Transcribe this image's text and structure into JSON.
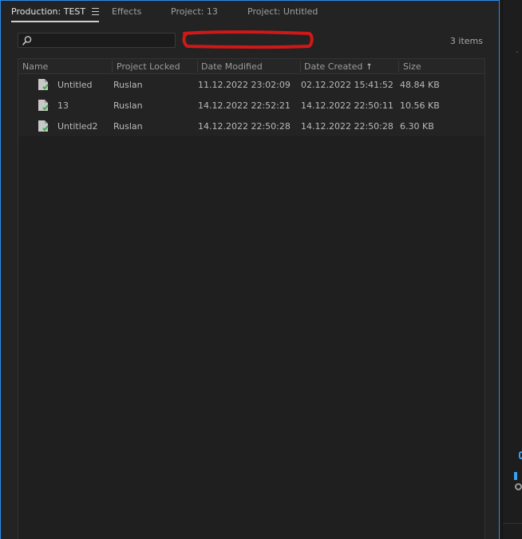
{
  "tabs": [
    {
      "label": "Production: TEST",
      "active": true
    },
    {
      "label": "Effects",
      "active": false
    },
    {
      "label": "Project: 13",
      "active": false
    },
    {
      "label": "Project: Untitled",
      "active": false
    }
  ],
  "search": {
    "value": "",
    "placeholder": ""
  },
  "item_count": "3 items",
  "columns": {
    "name": "Name",
    "locked": "Project Locked",
    "modified": "Date Modified",
    "created": "Date Created",
    "size": "Size"
  },
  "sort_indicator": "↑",
  "rows": [
    {
      "name": "Untitled",
      "locked": "Ruslan",
      "modified": "11.12.2022 23:02:09",
      "created": "02.12.2022 15:41:52",
      "size": "48.84 KB"
    },
    {
      "name": "13",
      "locked": "Ruslan",
      "modified": "14.12.2022 22:52:21",
      "created": "14.12.2022 22:50:11",
      "size": "10.56 KB"
    },
    {
      "name": "Untitled2",
      "locked": "Ruslan",
      "modified": "14.12.2022 22:50:28",
      "created": "14.12.2022 22:50:28",
      "size": "6.30 KB"
    }
  ],
  "colors": {
    "accent": "#2d8ceb",
    "file_icon": "#c8c8c8",
    "file_badge": "#3fa84a",
    "redaction": "#d01818"
  },
  "icons": {
    "tab_menu": "hamburger-menu-icon",
    "search": "search-icon",
    "file": "premiere-project-file-icon"
  }
}
